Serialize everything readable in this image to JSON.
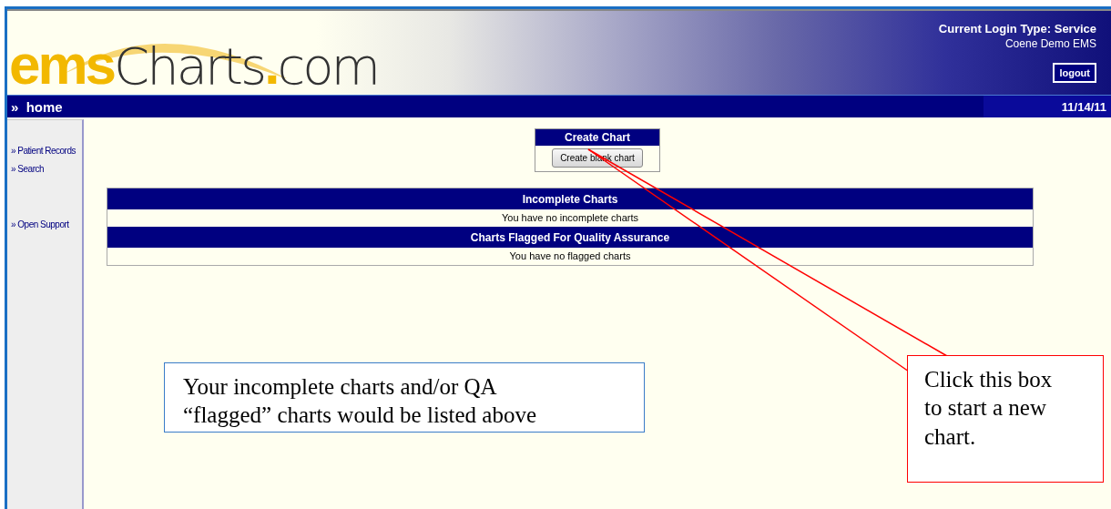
{
  "header": {
    "logo": [
      {
        "text": "ems",
        "accent": true
      },
      {
        "text": "Charts",
        "accent": false
      },
      {
        "text": ".",
        "accent": true
      },
      {
        "text": "com",
        "accent": false
      }
    ],
    "login_type": "Current Login Type: Service",
    "service": "Coene Demo EMS",
    "logout": "logout"
  },
  "nav": {
    "arrow": "»",
    "title": "home",
    "date": "11/14/11"
  },
  "sidebar": {
    "groups": [
      {
        "items": [
          "» Patient Records",
          "» Search"
        ]
      },
      {
        "items": [
          "» Open Support"
        ]
      }
    ]
  },
  "create_chart": {
    "title": "Create Chart",
    "button": "Create blank chart"
  },
  "sections": [
    {
      "title": "Incomplete Charts",
      "message": "You have no incomplete charts"
    },
    {
      "title": "Charts Flagged For Quality Assurance",
      "message": "You have no flagged charts"
    }
  ],
  "notes": [
    {
      "kind": "box",
      "text": "Your incomplete charts and/or QA “flagged” charts would be listed above"
    },
    {
      "kind": "pointer",
      "text": "Click this box to start a new chart."
    }
  ]
}
